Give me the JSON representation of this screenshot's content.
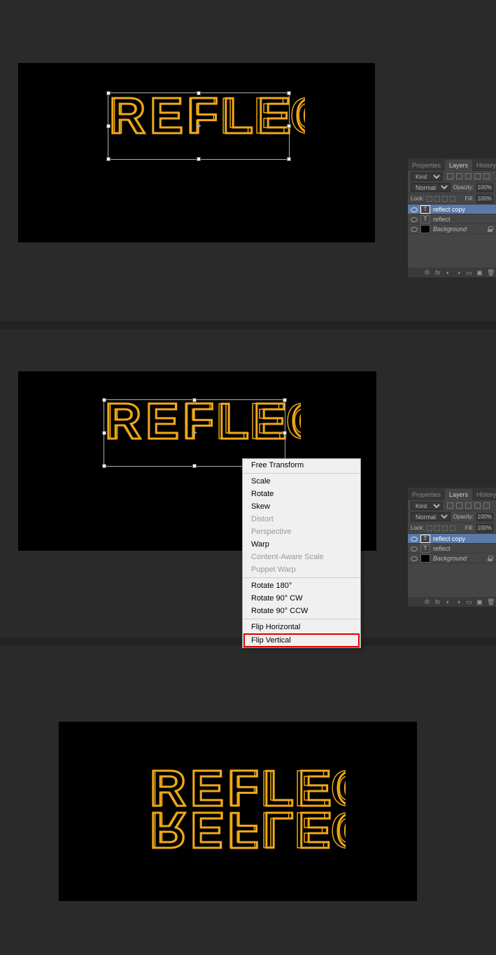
{
  "canvas_text": "REFLECT",
  "panel": {
    "tabs": {
      "properties": "Properties",
      "layers": "Layers",
      "history": "History"
    },
    "kind_label": "Kind",
    "blend_mode": "Normal",
    "opacity_label": "Opacity:",
    "opacity_value": "100%",
    "lock_label": "Lock:",
    "fill_label": "Fill:",
    "fill_value": "100%",
    "layers": [
      {
        "name": "reflect copy",
        "type": "T",
        "selected": true
      },
      {
        "name": "reflect",
        "type": "T",
        "selected": false
      },
      {
        "name": "Background",
        "type": "BG",
        "selected": false,
        "locked": true,
        "italic": true
      }
    ]
  },
  "context_menu": {
    "items": [
      {
        "label": "Free Transform",
        "enabled": true
      },
      {
        "sep": true
      },
      {
        "label": "Scale",
        "enabled": true
      },
      {
        "label": "Rotate",
        "enabled": true
      },
      {
        "label": "Skew",
        "enabled": true
      },
      {
        "label": "Distort",
        "enabled": false
      },
      {
        "label": "Perspective",
        "enabled": false
      },
      {
        "label": "Warp",
        "enabled": true
      },
      {
        "label": "Content-Aware Scale",
        "enabled": false
      },
      {
        "label": "Puppet Warp",
        "enabled": false
      },
      {
        "sep": true
      },
      {
        "label": "Rotate 180°",
        "enabled": true
      },
      {
        "label": "Rotate 90° CW",
        "enabled": true
      },
      {
        "label": "Rotate 90° CCW",
        "enabled": true
      },
      {
        "sep": true
      },
      {
        "label": "Flip Horizontal",
        "enabled": true
      },
      {
        "label": "Flip Vertical",
        "enabled": true,
        "highlighted": true
      }
    ]
  }
}
